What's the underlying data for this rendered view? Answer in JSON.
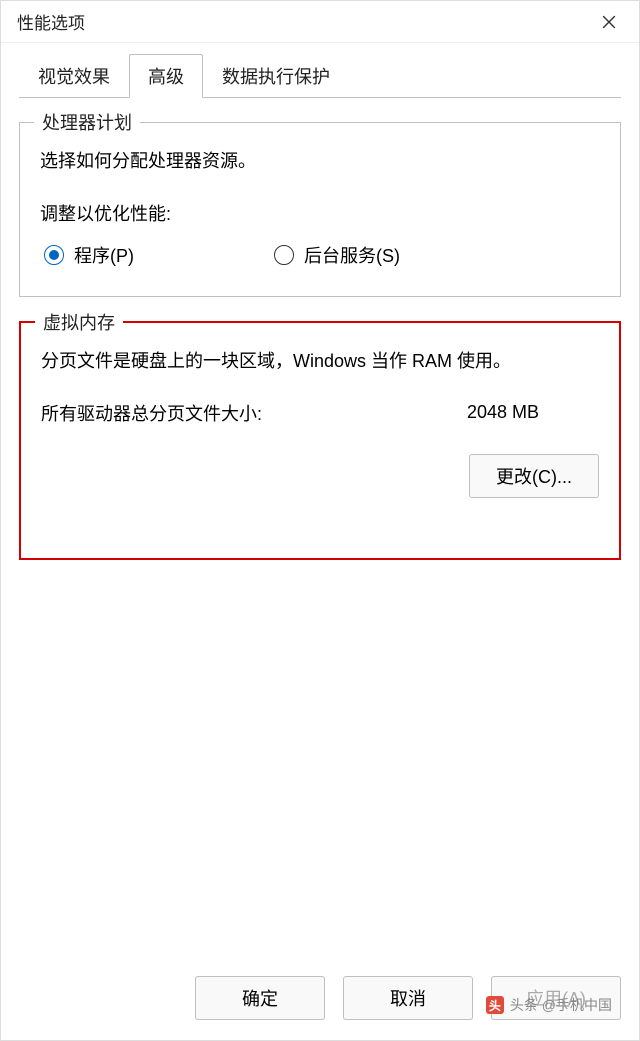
{
  "window": {
    "title": "性能选项"
  },
  "tabs": {
    "visual": "视觉效果",
    "advanced": "高级",
    "dep": "数据执行保护"
  },
  "processor": {
    "title": "处理器计划",
    "desc": "选择如何分配处理器资源。",
    "adjust_label": "调整以优化性能:",
    "radio_programs": "程序(P)",
    "radio_background": "后台服务(S)"
  },
  "virtual_memory": {
    "title": "虚拟内存",
    "desc": "分页文件是硬盘上的一块区域，Windows 当作 RAM 使用。",
    "total_label": "所有驱动器总分页文件大小:",
    "total_value": "2048 MB",
    "change_button": "更改(C)..."
  },
  "footer": {
    "ok": "确定",
    "cancel": "取消",
    "apply": "应用(A)"
  },
  "watermark": {
    "text": "头条 @手机中国"
  }
}
